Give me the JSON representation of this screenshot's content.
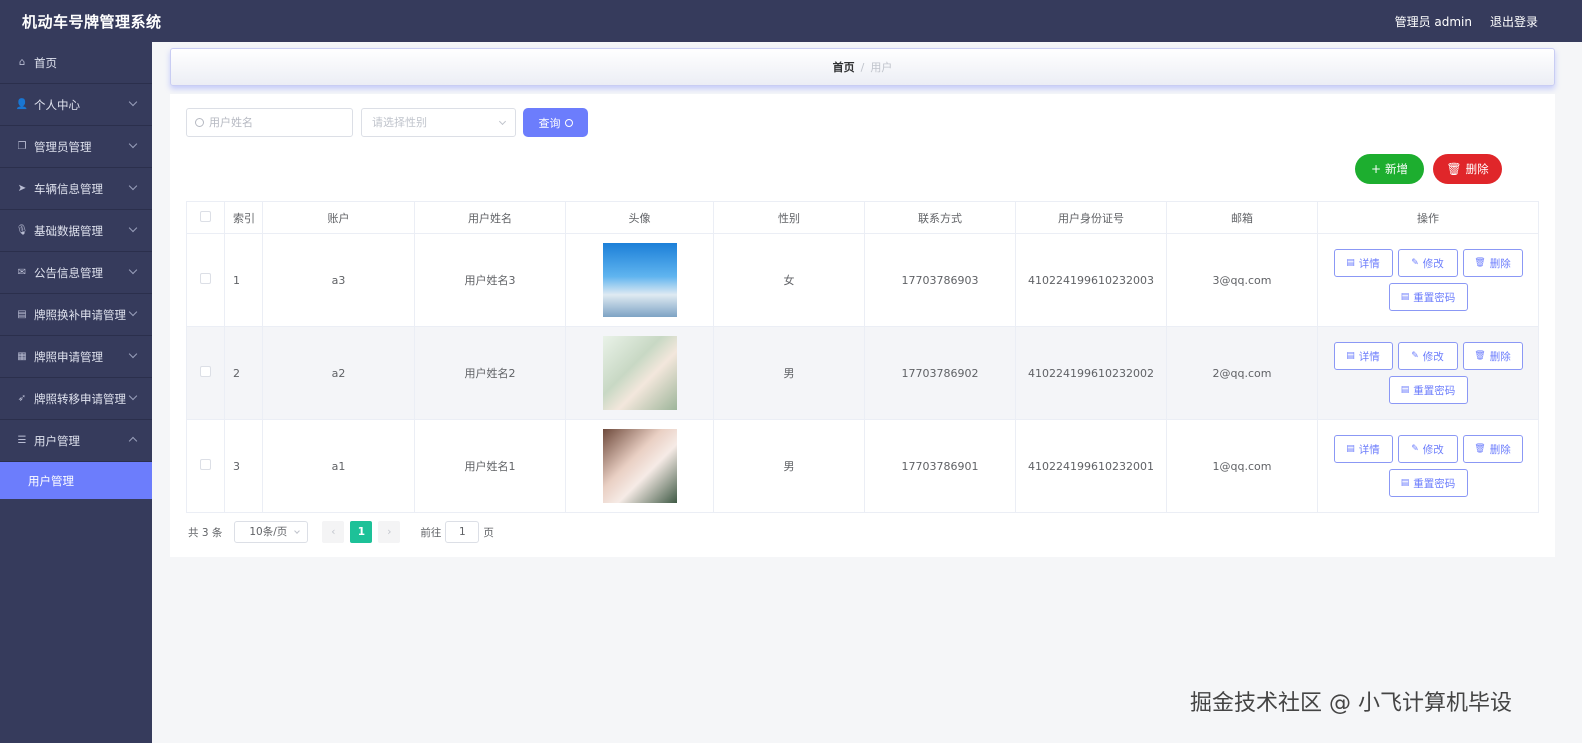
{
  "header": {
    "title": "机动车号牌管理系统",
    "user": "管理员 admin",
    "logout": "退出登录"
  },
  "sidebar": {
    "items": [
      {
        "label": "首页",
        "icon": "home-icon",
        "glyph": "⌂",
        "chevron": ""
      },
      {
        "label": "个人中心",
        "icon": "user-icon",
        "glyph": "👤",
        "chevron": "down"
      },
      {
        "label": "管理员管理",
        "icon": "copy-icon",
        "glyph": "❐",
        "chevron": "down"
      },
      {
        "label": "车辆信息管理",
        "icon": "send-icon",
        "glyph": "➤",
        "chevron": "down"
      },
      {
        "label": "基础数据管理",
        "icon": "mic-icon",
        "glyph": "🎙",
        "chevron": "down"
      },
      {
        "label": "公告信息管理",
        "icon": "mail-icon",
        "glyph": "✉",
        "chevron": "down"
      },
      {
        "label": "牌照换补申请管理",
        "icon": "doc-icon",
        "glyph": "▤",
        "chevron": "down"
      },
      {
        "label": "牌照申请管理",
        "icon": "grid-icon",
        "glyph": "▦",
        "chevron": "down"
      },
      {
        "label": "牌照转移申请管理",
        "icon": "navigate-icon",
        "glyph": "➶",
        "chevron": "down"
      },
      {
        "label": "用户管理",
        "icon": "list-icon",
        "glyph": "☰",
        "chevron": "up"
      }
    ],
    "submenu": {
      "label": "用户管理"
    }
  },
  "breadcrumb": {
    "home": "首页",
    "sep": "/",
    "current": "用户"
  },
  "search": {
    "name_placeholder": "用户姓名",
    "gender_placeholder": "请选择性别",
    "query_label": "查询"
  },
  "actions": {
    "add_label": "新增",
    "delete_label": "删除"
  },
  "table": {
    "columns": [
      "索引",
      "账户",
      "用户姓名",
      "头像",
      "性别",
      "联系方式",
      "用户身份证号",
      "邮箱",
      "操作"
    ],
    "rows": [
      {
        "index": "1",
        "account": "a3",
        "name": "用户姓名3",
        "gender": "女",
        "phone": "17703786903",
        "id_card": "410224199610232003",
        "email": "3@qq.com"
      },
      {
        "index": "2",
        "account": "a2",
        "name": "用户姓名2",
        "gender": "男",
        "phone": "17703786902",
        "id_card": "410224199610232002",
        "email": "2@qq.com"
      },
      {
        "index": "3",
        "account": "a1",
        "name": "用户姓名1",
        "gender": "男",
        "phone": "17703786901",
        "id_card": "410224199610232001",
        "email": "1@qq.com"
      }
    ],
    "op_labels": {
      "detail": "详情",
      "edit": "修改",
      "delete": "删除",
      "reset": "重置密码"
    }
  },
  "pagination": {
    "total": "共 3 条",
    "page_size": "10条/页",
    "prev": "‹",
    "next": "›",
    "current_page": "1",
    "goto_label": "前往",
    "goto_value": "1",
    "page_suffix": "页"
  },
  "watermark": "掘金技术社区 @ 小飞计算机毕设",
  "colors": {
    "header_bg": "#363b5c",
    "accent": "#6c7dfc",
    "add": "#1dae2f",
    "delete": "#e0262a",
    "active_page": "#1dc198"
  }
}
